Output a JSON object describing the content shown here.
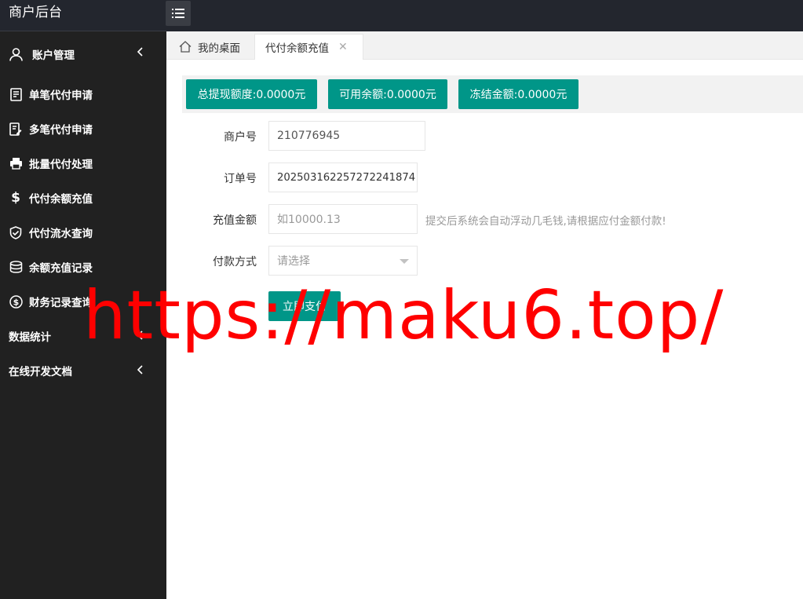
{
  "brand": {
    "title": "商户后台"
  },
  "sidebar": {
    "items": [
      {
        "label": "账户管理",
        "icon": "user-icon",
        "has_chevron": true
      },
      {
        "label": "单笔代付申请",
        "icon": "document-icon"
      },
      {
        "label": "多笔代付申请",
        "icon": "edit-document-icon"
      },
      {
        "label": "批量代付处理",
        "icon": "printer-icon"
      },
      {
        "label": "代付余额充值",
        "icon": "dollar-icon"
      },
      {
        "label": "代付流水查询",
        "icon": "shield-check-icon"
      },
      {
        "label": "余额充值记录",
        "icon": "database-icon"
      },
      {
        "label": "财务记录查询",
        "icon": "dollar-circle-icon"
      },
      {
        "label": "数据统计",
        "has_chevron": true
      },
      {
        "label": "在线开发文档",
        "has_chevron": true
      }
    ]
  },
  "tabs": {
    "home": "我的桌面",
    "active": "代付余额充值"
  },
  "balances": {
    "total_withdraw": "总提现额度:0.0000元",
    "available": "可用余额:0.0000元",
    "frozen": "冻结金额:0.0000元"
  },
  "form": {
    "merchant_label": "商户号",
    "merchant_value": "210776945",
    "order_label": "订单号",
    "order_value": "20250316225727224187​4",
    "amount_label": "充值金额",
    "amount_placeholder": "如10000.13",
    "amount_hint": "提交后系统会自动浮动几毛钱,请根据应付金额付款!",
    "payment_label": "付款方式",
    "payment_placeholder": "请选择",
    "submit_label": "立即支付"
  },
  "watermark": {
    "text": "https://maku6.top/"
  },
  "colors": {
    "accent": "#009688",
    "sidebar_bg": "#212121",
    "topbar_bg": "#23262e",
    "watermark": "#ff0000"
  }
}
